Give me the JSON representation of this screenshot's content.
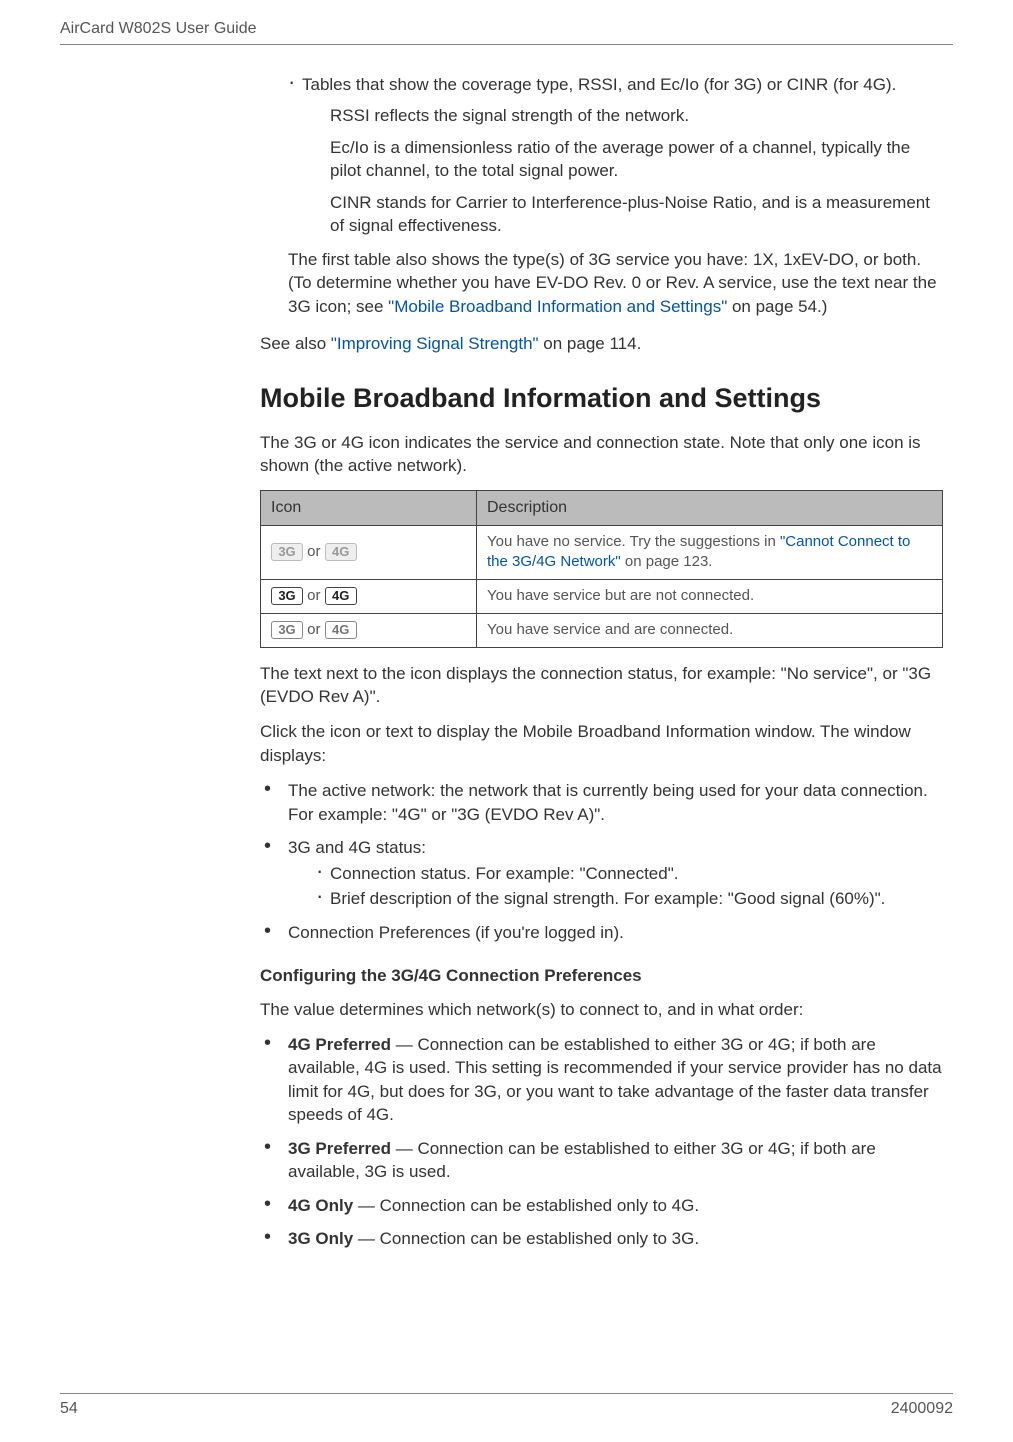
{
  "header": {
    "title": "AirCard W802S User Guide"
  },
  "intro": {
    "bullet1": "Tables that show the coverage type, RSSI, and Ec/Io (for 3G) or CINR (for 4G).",
    "inner1": "RSSI reflects the signal strength of the network.",
    "inner2": "Ec/Io is a dimensionless ratio of the average power of a channel, typically the pilot channel, to the total signal power.",
    "inner3": "CINR stands for Carrier to Interference-plus-Noise Ratio, and is a measurement of signal effectiveness.",
    "after_bullet_pre": "The first table also shows the type(s) of 3G service you have: 1X, 1xEV-DO, or both. (To determine whether you have EV-DO Rev. 0 or Rev. A service, use the text near the 3G icon; see ",
    "after_bullet_link": "\"Mobile Broadband Information and Settings\"",
    "after_bullet_post": " on page 54.)",
    "see_also_pre": "See also ",
    "see_also_link": "\"Improving Signal Strength\"",
    "see_also_post": " on page 114."
  },
  "section": {
    "title": "Mobile Broadband Information and Settings",
    "lead": "The 3G or 4G icon indicates the service and connection state. Note that only one icon is shown (the active network).",
    "table": {
      "head_icon": "Icon",
      "head_desc": "Description",
      "rows": [
        {
          "icon_or": " or ",
          "desc_pre": "You have no service. Try the suggestions in ",
          "desc_link": "\"Cannot Connect to the 3G/4G Network\"",
          "desc_post": " on page 123."
        },
        {
          "icon_or": " or ",
          "desc": "You have service but are not connected."
        },
        {
          "icon_or": " or ",
          "desc": "You have service and are connected."
        }
      ]
    },
    "after_table1": "The text next to the icon displays the connection status, for example: \"No service\", or \"3G (EVDO Rev A)\".",
    "after_table2": "Click the icon or text to display the Mobile Broadband Information window. The window displays:",
    "bullets": {
      "b1": "The active network: the network that is currently being used for your data connection. For example: \"4G\" or \"3G (EVDO Rev A)\".",
      "b2": "3G and 4G status:",
      "b2a": "Connection status. For example: \"Connected\".",
      "b2b": "Brief description of the signal strength. For example: \"Good signal (60%)\".",
      "b3": "Connection Preferences (if you're logged in)."
    }
  },
  "config": {
    "heading": "Configuring the 3G/4G Connection Preferences",
    "lead": "The value determines which network(s) to connect to, and in what order:",
    "items": [
      {
        "label": "4G Preferred",
        "text": " — Connection can be established to either 3G or 4G; if both are available, 4G is used. This setting is recommended if your service provider has no data limit for 4G, but does for 3G, or you want to take advantage of the faster data transfer speeds of 4G."
      },
      {
        "label": "3G Preferred",
        "text": " — Connection can be established to either 3G or 4G; if both are available, 3G is used."
      },
      {
        "label": "4G Only",
        "text": " — Connection can be established only to 4G."
      },
      {
        "label": "3G Only",
        "text": " — Connection can be established only to 3G."
      }
    ]
  },
  "footer": {
    "page": "54",
    "docnum": "2400092"
  },
  "icons": {
    "g3": "3G",
    "g4": "4G"
  }
}
